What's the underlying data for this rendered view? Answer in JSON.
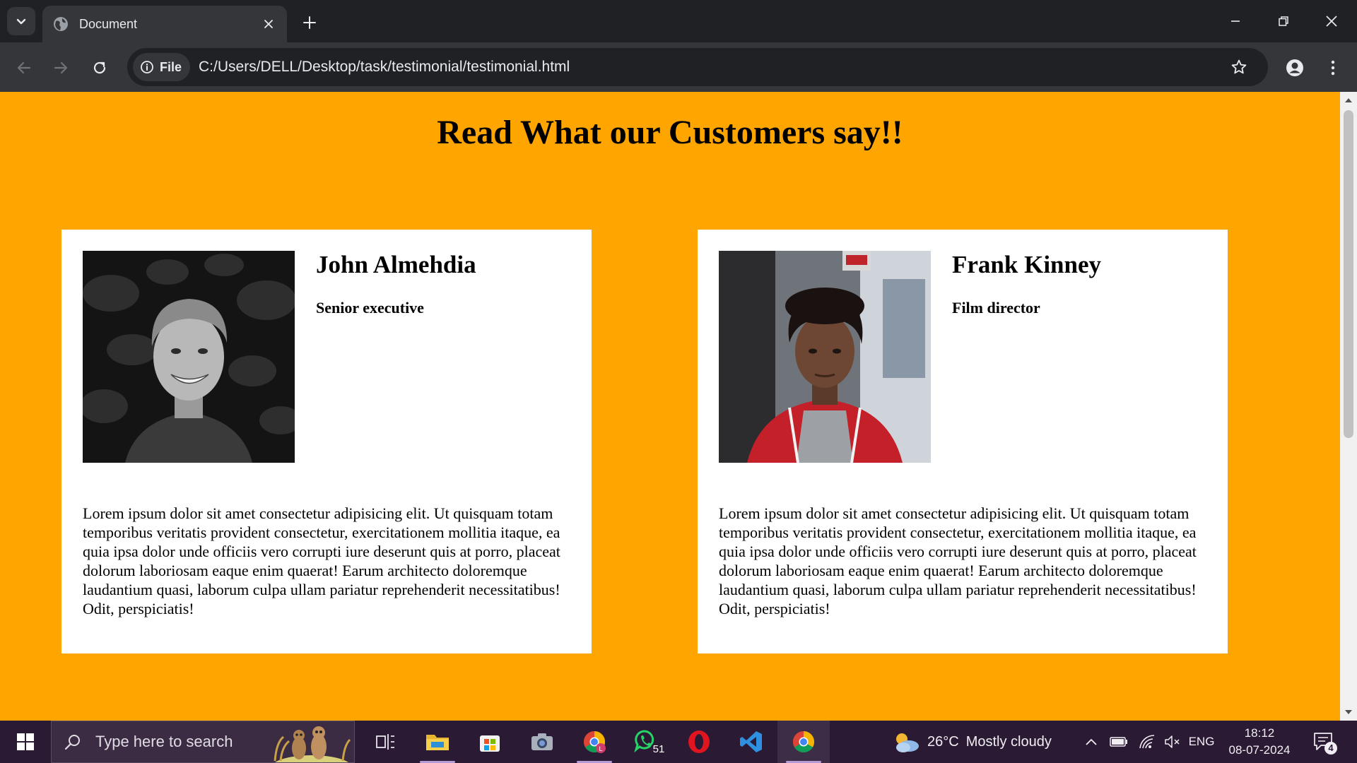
{
  "browser": {
    "tab_title": "Document",
    "omnibox_chip": "File",
    "url": "C:/Users/DELL/Desktop/task/testimonial/testimonial.html"
  },
  "page": {
    "heading": "Read What our Customers say!!",
    "background_color": "#ffa500",
    "testimonials": [
      {
        "name": "John Almehdia",
        "role": "Senior executive",
        "photo": "black-and-white portrait of smiling young man",
        "text": "Lorem ipsum dolor sit amet consectetur adipisicing elit. Ut quisquam totam temporibus veritatis provident consectetur, exercitationem mollitia itaque, ea quia ipsa dolor unde officiis vero corrupti iure deserunt quis at porro, placeat dolorum laboriosam eaque enim quaerat! Earum architecto doloremque laudantium quasi, laborum culpa ullam pariatur reprehenderit necessitatibus! Odit, perspiciatis!"
      },
      {
        "name": "Frank Kinney",
        "role": "Film director",
        "photo": "color portrait of young man in red jacket",
        "text": "Lorem ipsum dolor sit amet consectetur adipisicing elit. Ut quisquam totam temporibus veritatis provident consectetur, exercitationem mollitia itaque, ea quia ipsa dolor unde officiis vero corrupti iure deserunt quis at porro, placeat dolorum laboriosam eaque enim quaerat! Earum architecto doloremque laudantium quasi, laborum culpa ullam pariatur reprehenderit necessitatibus! Odit, perspiciatis!"
      }
    ]
  },
  "taskbar": {
    "search_placeholder": "Type here to search",
    "whatsapp_badge": "51",
    "weather_temp": "26°C",
    "weather_desc": "Mostly cloudy",
    "language": "ENG",
    "time": "18:12",
    "date": "08-07-2024",
    "notification_count": "4",
    "apps": [
      "task-view",
      "file-explorer",
      "microsoft-store",
      "camera",
      "chrome-profile",
      "whatsapp",
      "opera",
      "vscode",
      "chrome"
    ]
  }
}
